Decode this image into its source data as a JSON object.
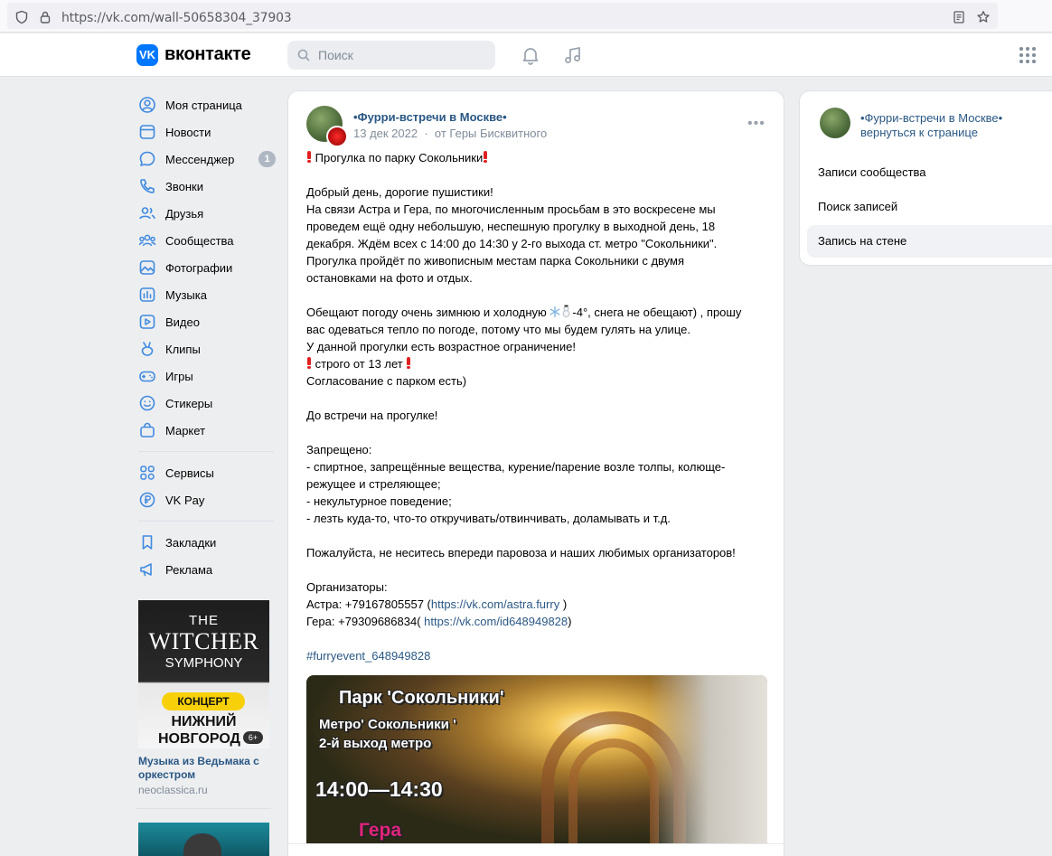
{
  "browser": {
    "url": "https://vk.com/wall-50658304_37903"
  },
  "header": {
    "logo_mark": "VK",
    "logo_text": "вконтакте",
    "search_placeholder": "Поиск"
  },
  "nav": {
    "items": [
      {
        "label": "Моя страница",
        "icon": "user-icon"
      },
      {
        "label": "Новости",
        "icon": "news-icon"
      },
      {
        "label": "Мессенджер",
        "icon": "message-icon",
        "badge": "1"
      },
      {
        "label": "Звонки",
        "icon": "phone-icon"
      },
      {
        "label": "Друзья",
        "icon": "friends-icon"
      },
      {
        "label": "Сообщества",
        "icon": "communities-icon"
      },
      {
        "label": "Фотографии",
        "icon": "photos-icon"
      },
      {
        "label": "Музыка",
        "icon": "music-icon"
      },
      {
        "label": "Видео",
        "icon": "video-icon"
      },
      {
        "label": "Клипы",
        "icon": "clips-icon"
      },
      {
        "label": "Игры",
        "icon": "games-icon"
      },
      {
        "label": "Стикеры",
        "icon": "stickers-icon"
      },
      {
        "label": "Маркет",
        "icon": "market-icon"
      }
    ],
    "items2": [
      {
        "label": "Сервисы",
        "icon": "services-icon"
      },
      {
        "label": "VK Pay",
        "icon": "vkpay-icon"
      }
    ],
    "items3": [
      {
        "label": "Закладки",
        "icon": "bookmark-icon"
      },
      {
        "label": "Реклама",
        "icon": "ads-icon"
      }
    ]
  },
  "ad": {
    "img_line1": "THE",
    "img_line2": "WITCHER",
    "img_line3": "SYMPHONY",
    "img_pill": "КОНЦЕРТ",
    "img_city1": "НИЖНИЙ",
    "img_city2": "НОВГОРОД",
    "img_age": "6+",
    "title": "Музыка из Ведьмака с оркестром",
    "domain": "neoclassica.ru"
  },
  "post": {
    "group": "•Фурри-встречи в Москве•",
    "date": "13 дек 2022",
    "author": "от Геры Бисквитного",
    "title": "Прогулка по парку Сокольники",
    "lines": [
      "Добрый день, дорогие пушистики!",
      "На связи Астра и Гера, по многочисленным просьбам в это воскресене мы",
      "проведем ещё одну небольшую, неспешную прогулку в выходной день, 18",
      "декабря. Ждём всех с 14:00 до 14:30 у 2-го выхода ст. метро \"Сокольники\".",
      "Прогулка пройдёт по живописным местам парка Сокольники с двумя",
      "остановками на фото и отдых."
    ],
    "weather_a": "Обещают погоду очень зимнюю и холодную",
    "weather_b": "-4°, снега не обещают) , прошу",
    "lines2": [
      "вас одеваться тепло по погоде, потому что мы будем гулять на улице.",
      "У данной прогулки есть возрастное ограничение!"
    ],
    "age": "строго от 13 лет",
    "agreement": "Согласование с парком есть)",
    "see_you": "До встречи на прогулке!",
    "forbidden_title": "Запрещено:",
    "forbidden": [
      "- спиртное, запрещённые вещества, курение/парение возле толпы, колюще-",
      "режущее и стреляющее;",
      "- некультурное поведение;",
      "- лезть куда-то, что-то откручивать/отвинчивать, доламывать и т.д."
    ],
    "please": "Пожалуйста, не неситесь впереди паровоза и наших любимых организаторов!",
    "organizers": "Организаторы:",
    "org1_prefix": "Астра: +79167805557 (",
    "org1_link": "https://vk.com/astra.furry",
    "org1_suffix": " )",
    "org2_prefix": "Гера: +79309686834( ",
    "org2_link": "https://vk.com/id648949828",
    "org2_suffix": ")",
    "hashtag": "#furryevent_648949828",
    "photo": {
      "line1": "Парк 'Сокольники'",
      "line2": "Метро' Сокольники '",
      "line3": "2-й выход метро",
      "time": "14:00—14:30",
      "name": "Гера"
    }
  },
  "right": {
    "group": "•Фурри-встречи в Москве•",
    "back": "вернуться к странице",
    "items": [
      "Записи сообщества",
      "Поиск записей",
      "Запись на стене"
    ]
  }
}
